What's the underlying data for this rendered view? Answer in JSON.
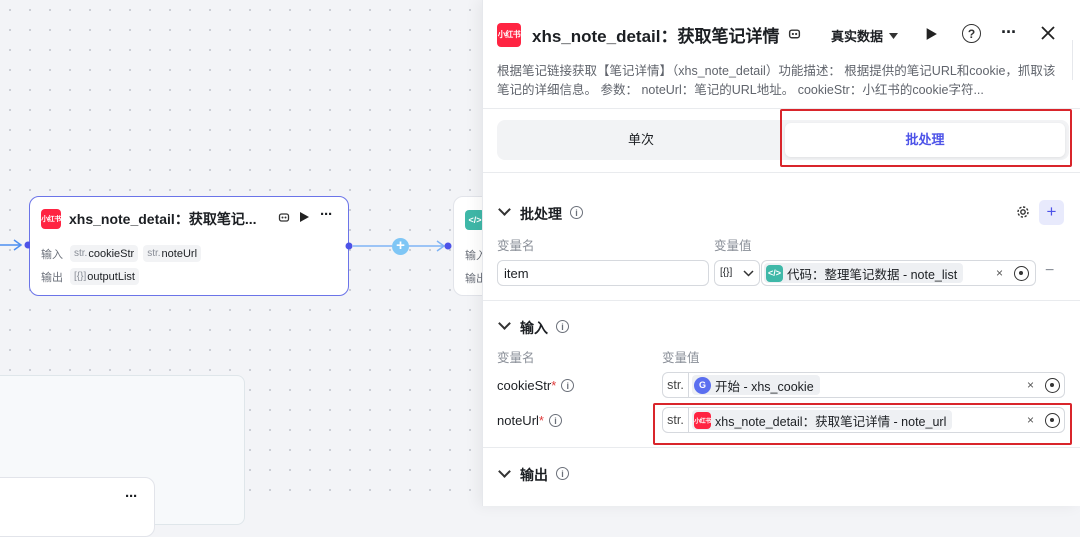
{
  "canvas": {
    "node_main": {
      "title": "xhs_note_detail：获取笔记...",
      "logo_text": "小红书",
      "input_label": "输入",
      "output_label": "输出",
      "inputs": [
        {
          "type": "str.",
          "name": "cookieStr"
        },
        {
          "type": "str.",
          "name": "noteUrl"
        }
      ],
      "outputs": [
        {
          "type": "[{}]",
          "name": "outputList"
        }
      ]
    },
    "node_code": {
      "input_label": "输入",
      "output_label": "输出"
    },
    "add_symbol": "+",
    "more_symbol": "···"
  },
  "panel": {
    "title": "xhs_note_detail：获取笔记详情",
    "logo_text": "小红书",
    "data_mode": "真实数据",
    "description": "根据笔记链接获取【笔记详情】（xhs_note_detail）功能描述： 根据提供的笔记URL和cookie，抓取该笔记的详细信息。 参数： noteUrl：笔记的URL地址。 cookieStr：小红书的cookie字符...",
    "tabs": {
      "single": "单次",
      "batch": "批处理"
    },
    "batch": {
      "title": "批处理",
      "col_name": "变量名",
      "col_value": "变量值",
      "row": {
        "name": "item",
        "type": "[{}]",
        "ref_icon": "</>",
        "ref_text": "代码：整理笔记数据 - note_list"
      }
    },
    "input": {
      "title": "输入",
      "col_name": "变量名",
      "col_value": "变量值",
      "rows": [
        {
          "name": "cookieStr",
          "required": "*",
          "type": "str.",
          "ref_icon": "G",
          "ref_text": "开始 - xhs_cookie",
          "accent": "#5b6ff0"
        },
        {
          "name": "noteUrl",
          "required": "*",
          "type": "str.",
          "ref_icon": "小红书",
          "ref_text": "xhs_note_detail：获取笔记详情 - note_url",
          "accent": "#ff2442"
        }
      ]
    },
    "output": {
      "title": "输出"
    },
    "colors": {
      "accent": "#4d53e8",
      "highlight": "#d9252b",
      "code": "#3fb8a8"
    }
  }
}
